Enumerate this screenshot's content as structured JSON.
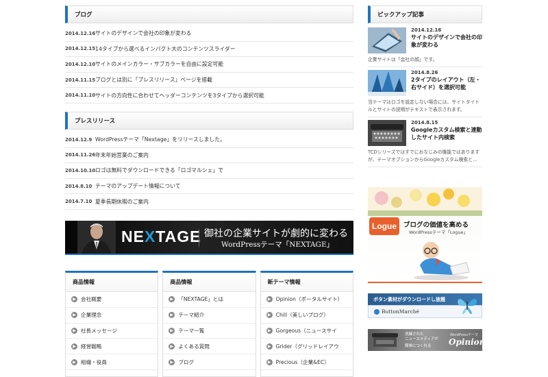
{
  "blog": {
    "heading": "ブログ",
    "items": [
      {
        "date": "2014.12.16",
        "title": "サイトのデザインで会社の印象が変わる"
      },
      {
        "date": "2014.12.15",
        "title": "14タイプから選べるインパクト大のコンテンツスライダー"
      },
      {
        "date": "2014.12.10",
        "title": "サイトのメインカラー・サブカラーを自由に設定可能"
      },
      {
        "date": "2014.11.15",
        "title": "ブログとは別に「プレスリリース」ページを搭載"
      },
      {
        "date": "2014.11.10",
        "title": "サイトの方向性に合わせてヘッダーコンテンツを3タイプから選択可能"
      }
    ]
  },
  "press": {
    "heading": "プレスリリース",
    "items": [
      {
        "date": "2014.12.9",
        "title": "WordPressテーマ「Nextage」をリリースしました。"
      },
      {
        "date": "2014.11.26",
        "title": "年末年始営業のご案内"
      },
      {
        "date": "2014.10.10",
        "title": "ロゴは無料でダウンロードできる「ロゴマルシェ」で"
      },
      {
        "date": "2014.8.10",
        "title": "テーマのアップデート情報について"
      },
      {
        "date": "2014.7.10",
        "title": "夏季長期休暇のご案内"
      }
    ]
  },
  "banner": {
    "logo_a": "NE",
    "logo_x": "X",
    "logo_b": "TAGE",
    "copy": "御社の企業サイトが劇的に変わる",
    "sub": "WordPressテーマ「NEXTAGE」"
  },
  "boxes": [
    {
      "heading": "商品情報",
      "items": [
        "会社概要",
        "企業理念",
        "社長メッセージ",
        "経営戦略",
        "組織・役員"
      ]
    },
    {
      "heading": "商品情報",
      "items": [
        "「NEXTAGE」とは",
        "テーマ紹介",
        "テーマ一覧",
        "よくある質問",
        "ブログ"
      ]
    },
    {
      "heading": "新テーマ情報",
      "items": [
        "Opinion（ポータルサイト）",
        "Chill（美しいブログ）",
        "Gorgeous（ニュースサイ",
        "Grider（グリッドレイアウ",
        "Precious（企業&EC）"
      ]
    }
  ],
  "pickup": {
    "heading": "ピックアップ記事",
    "items": [
      {
        "date": "2014.12.16",
        "title": "サイトのデザインで会社の印象が変わる",
        "desc": "企業サイトは「会社の顔」です。"
      },
      {
        "date": "2014.8.26",
        "title": "2タイプのレイアウト（左・右サイド）を選択可能",
        "desc": "当テーマはロゴを設定しない場合には、サイトタイトルとサイトの説明がテキストで表示されます。"
      },
      {
        "date": "2014.8.15",
        "title": "Googleカスタム検索と連動したサイト内検索",
        "desc": "TCDシリーズではすでにおなじみの機能ではありますが、テーマオプションからGoogleカスタム検索と…"
      }
    ]
  },
  "ads": {
    "logue_badge": "Logue",
    "logue_title": "ブログの価値を高める",
    "logue_sub": "WordPressテーマ「Logue」",
    "button_top": "ボタン素材がダウンロードし放題",
    "button_brand": "ButtonMarché",
    "opinion_copy1": "洗練された",
    "opinion_copy2": "ニュースメディアが",
    "opinion_copy3": "簡単につくれる",
    "opinion_small": "WordPressテーマ",
    "opinion_brand": "Opinion"
  },
  "colors": {
    "accent": "#1e73be",
    "logue": "#e8602c"
  }
}
